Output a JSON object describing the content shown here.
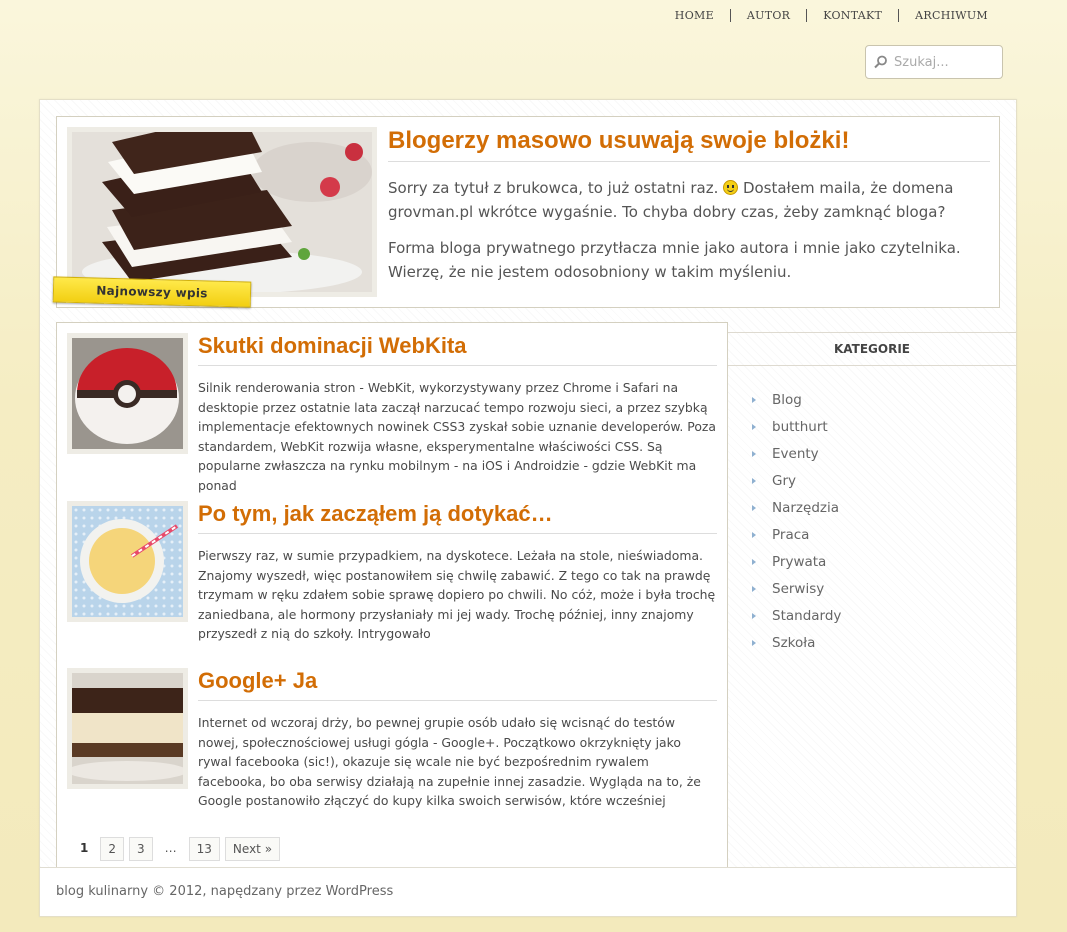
{
  "nav": {
    "items": [
      "HOME",
      "AUTOR",
      "KONTAKT",
      "ARCHIWUM"
    ]
  },
  "search": {
    "placeholder": "Szukaj..."
  },
  "featured": {
    "badge": "Najnowszy wpis",
    "title": "Blogerzy masowo usuwają swoje blożki!",
    "p1_before": "Sorry za tytuł z brukowca, to już ostatni raz.",
    "p1_after": "Dostałem maila, że domena grovman.pl wkrótce wygaśnie. To chyba dobry czas, żeby zamknąć bloga?",
    "p2": "Forma bloga prywatnego przytłacza mnie jako autora i mnie jako czytelnika. Wierzę, że nie jestem odosobniony w takim myśleniu."
  },
  "posts": [
    {
      "title": "Skutki dominacji WebKita",
      "excerpt": "Silnik renderowania stron - WebKit, wykorzystywany przez Chrome i Safari na desktopie przez ostatnie lata zaczął narzucać tempo rozwoju sieci, a przez szybką implementacje efektownych nowinek CSS3 zyskał sobie uznanie developerów. Poza standardem, WebKit rozwija własne, eksperymentalne właściwości CSS. Są popularne zwłaszcza na rynku mobilnym - na iOS i Androidzie - gdzie WebKit ma ponad"
    },
    {
      "title": "Po tym, jak zacząłem ją dotykać…",
      "excerpt": "Pierwszy raz, w sumie przypadkiem, na dyskotece. Leżała na stole, nieświadoma. Znajomy wyszedł, więc postanowiłem się chwilę zabawić. Z tego co tak na prawdę trzymam w ręku zdałem sobie sprawę dopiero po chwili. No cóż, może i była trochę zaniedbana, ale hormony przysłaniały mi jej wady. Trochę później, inny znajomy przyszedł z nią do szkoły. Intrygowało"
    },
    {
      "title": "Google+ Ja",
      "excerpt": "Internet od wczoraj drży, bo pewnej grupie osób udało się wcisnąć do testów nowej, społecznościowej usługi gógla - Google+. Początkowo okrzyknięty jako rywal facebooka (sic!), okazuje się wcale nie być bezpośrednim rywalem facebooka, bo oba serwisy działają na zupełnie innej zasadzie. Wygląda na to, że Google postanowiło złączyć do kupy kilka swoich serwisów, które wcześniej"
    }
  ],
  "pagination": {
    "current": "1",
    "pages": [
      "2",
      "3"
    ],
    "dots": "…",
    "last": "13",
    "next": "Next »"
  },
  "sidebar": {
    "heading": "KATEGORIE",
    "categories": [
      "Blog",
      "butthurt",
      "Eventy",
      "Gry",
      "Narzędzia",
      "Praca",
      "Prywata",
      "Serwisy",
      "Standardy",
      "Szkoła"
    ]
  },
  "footer": {
    "text": "blog kulinarny © 2012, napędzany przez",
    "link": "WordPress"
  }
}
